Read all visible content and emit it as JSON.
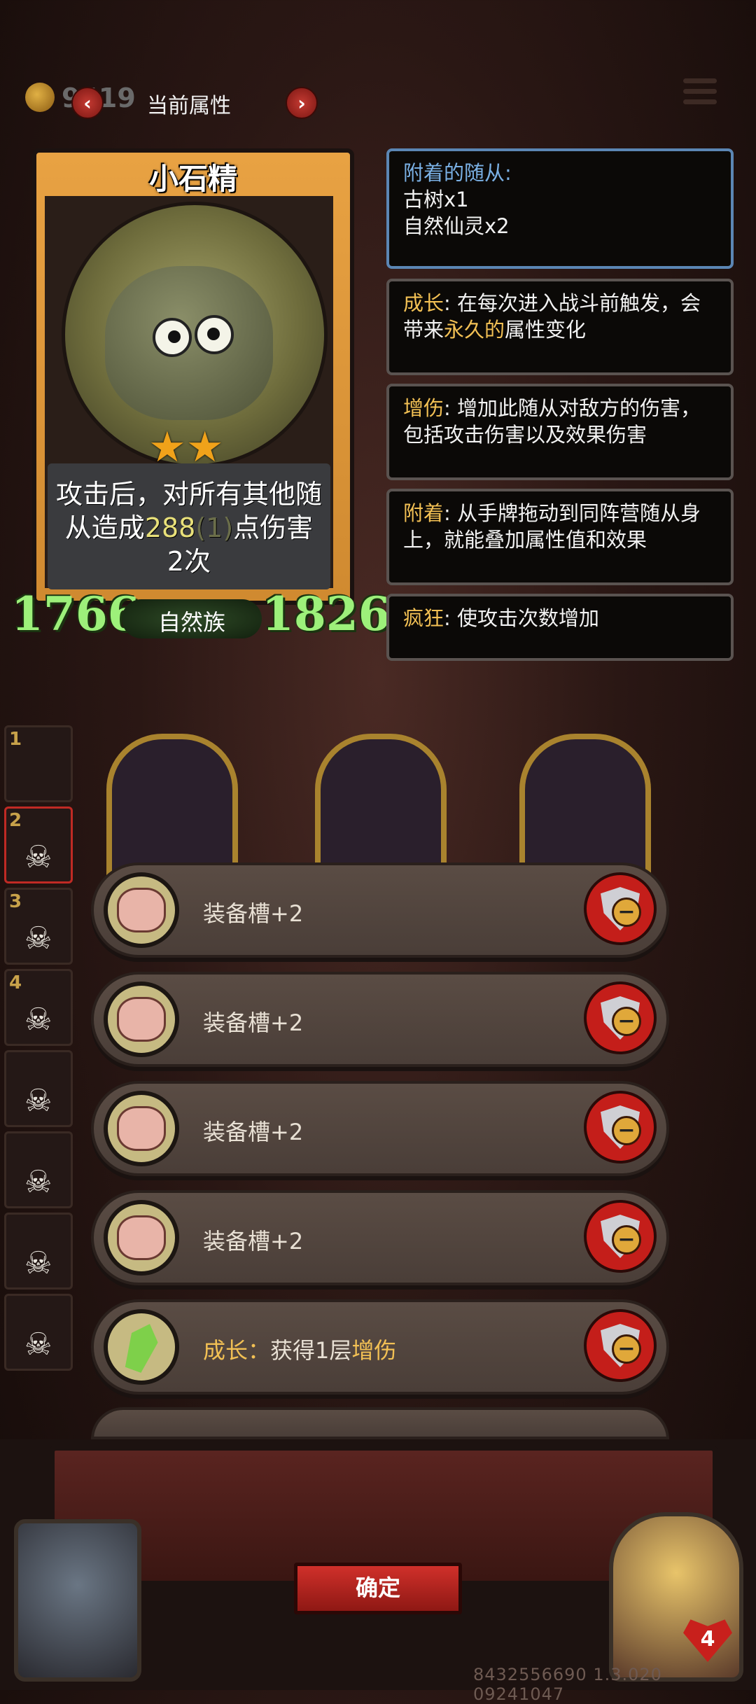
{
  "topbar": {
    "coin_count": "9419",
    "title": "当前属性",
    "prev_label": "‹",
    "next_label": "›"
  },
  "card": {
    "name": "小石精",
    "stars": "★★",
    "desc_line1": "攻击后，对所有其他随",
    "desc_line2_pre": "从造成",
    "desc_value": "288",
    "desc_sub": "(1)",
    "desc_line2_post": "点伤害",
    "desc_line3": "2次",
    "attack": "1766",
    "health": "1826",
    "tribe": "自然族"
  },
  "attached": {
    "title": "附着的随从:",
    "items": [
      "古树x1",
      "自然仙灵x2"
    ]
  },
  "keywords": [
    {
      "key": "成长",
      "pre": ": 在每次进入战斗前触发，会带来",
      "hl": "永久的",
      "post": "属性变化"
    },
    {
      "key": "增伤",
      "pre": ": 增加此随从对敌方的伤害，包括攻击伤害以及效果伤害",
      "hl": "",
      "post": ""
    },
    {
      "key": "附着",
      "pre": ": 从手牌拖动到同阵营随从身上，就能叠加属性值和效果",
      "hl": "",
      "post": ""
    },
    {
      "key": "疯狂",
      "pre": ": 使攻击次数增加",
      "hl": "",
      "post": ""
    }
  ],
  "roster": [
    "1",
    "2",
    "3",
    "4",
    "",
    "",
    "",
    ""
  ],
  "items": [
    {
      "label": "装备槽+2"
    },
    {
      "label": "装备槽+2"
    },
    {
      "label": "装备槽+2"
    },
    {
      "label": "装备槽+2"
    },
    {
      "key": "成长：",
      "pre": "获得1层",
      "val": "增伤"
    }
  ],
  "footer": {
    "confirm_label": "确定",
    "lives": "4",
    "version": "8432556690 1.3.020 09241047"
  },
  "colors": {
    "keyword": "#f2c054",
    "attached_title": "#7ab0e4",
    "stat_green": "#9df07a",
    "confirm_red": "#c41e1a"
  }
}
